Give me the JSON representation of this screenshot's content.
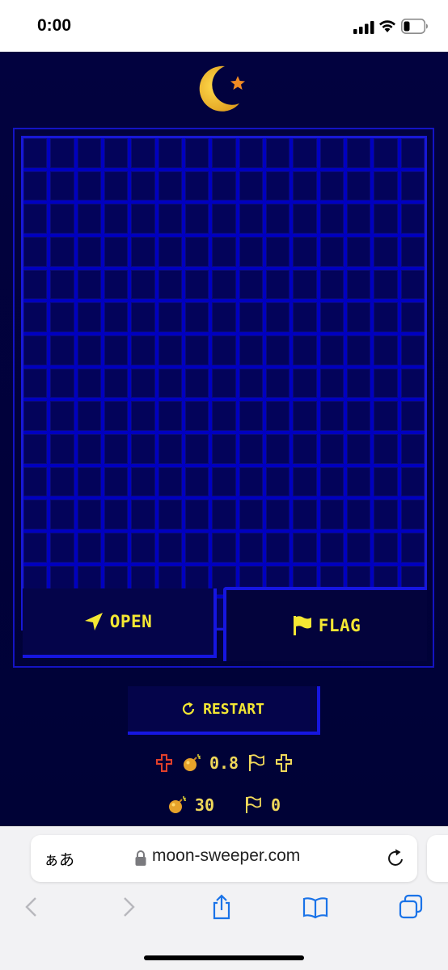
{
  "status": {
    "time": "0:00",
    "icons": [
      "signal-icon",
      "wifi-icon",
      "battery-icon"
    ]
  },
  "game": {
    "logo": "crescent-moon-star-icon",
    "board": {
      "rows": 15,
      "cols": 15
    },
    "controls": {
      "open_label": "OPEN",
      "open_icon": "arrow-pointer-icon",
      "flag_label": "FLAG",
      "flag_icon": "flag-icon",
      "restart_label": "RESTART",
      "restart_icon": "refresh-icon"
    },
    "stats": {
      "timer_value": "0.8",
      "mines_value": "30",
      "flags_value": "0"
    },
    "colors": {
      "background": "#02023f",
      "grid": "#0000c0",
      "accent": "#f4e733",
      "border": "#1616e0"
    }
  },
  "browser": {
    "text_size_label": "ぁあ",
    "url": "moon-sweeper.com",
    "toolbar": [
      "back-icon",
      "forward-icon",
      "share-icon",
      "bookmarks-icon",
      "tabs-icon"
    ]
  }
}
